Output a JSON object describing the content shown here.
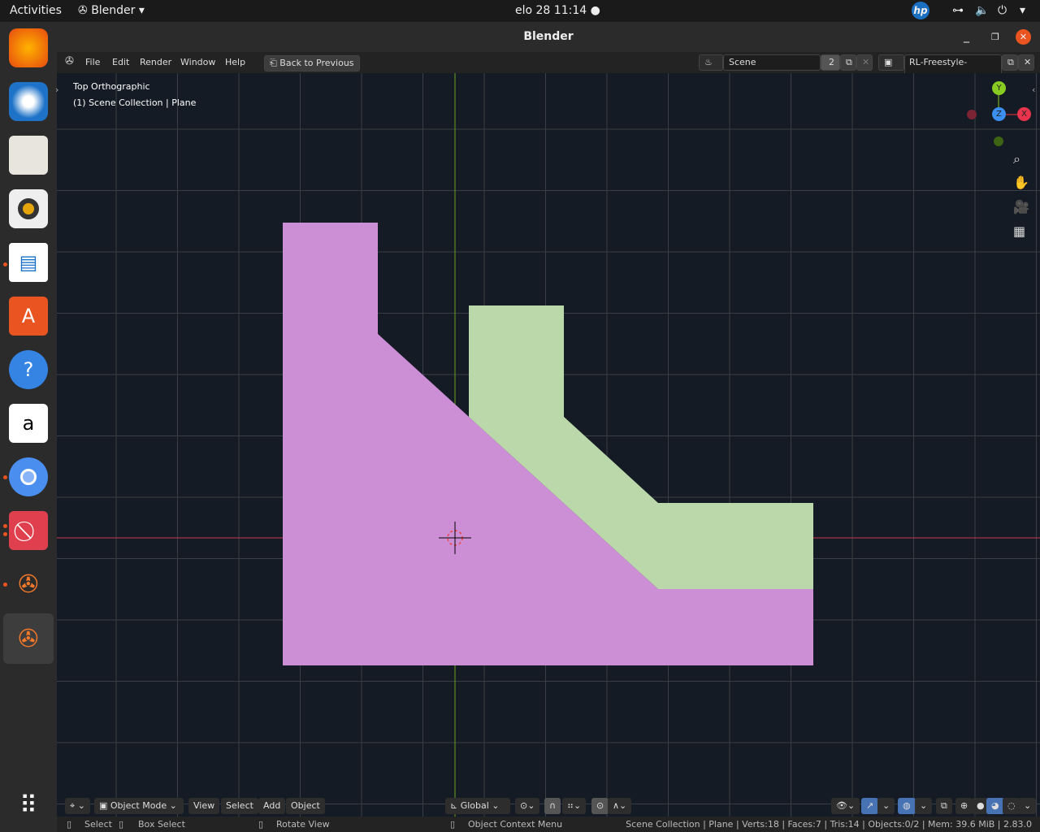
{
  "system": {
    "activities": "Activities",
    "app": "Blender",
    "clock": "elo 28  11:14"
  },
  "dock": [
    "firefox",
    "thunderbird",
    "files",
    "rhythmbox",
    "libreoffice-writer",
    "software",
    "help",
    "amazon",
    "chromium",
    "blocked-app",
    "blender",
    "blender-active",
    "show-apps"
  ],
  "window": {
    "title": "Blender"
  },
  "menu": {
    "items": [
      "File",
      "Edit",
      "Render",
      "Window",
      "Help"
    ],
    "back": "Back to Previous",
    "scene": "Scene",
    "scene_users": "2",
    "view_layer": "RL-Freestyle-LineSets"
  },
  "viewport": {
    "view_name": "Top Orthographic",
    "collection": "(1) Scene Collection | Plane",
    "gizmo": {
      "y": "Y",
      "z": "Z",
      "x": "X"
    },
    "colors": {
      "pink": "#cc8fd6",
      "green": "#bbd8aa",
      "x_axis": "#c8394e",
      "y_axis": "#6a9f1f"
    }
  },
  "header": {
    "mode": "Object Mode",
    "view": "View",
    "select": "Select",
    "add": "Add",
    "object": "Object",
    "orientation": "Global"
  },
  "status": {
    "select": "Select",
    "box_select": "Box Select",
    "rotate": "Rotate View",
    "context": "Object Context Menu",
    "stats": "Scene Collection | Plane | Verts:18 | Faces:7 | Tris:14 | Objects:0/2 | Mem: 39.6 MiB | 2.83.0"
  }
}
